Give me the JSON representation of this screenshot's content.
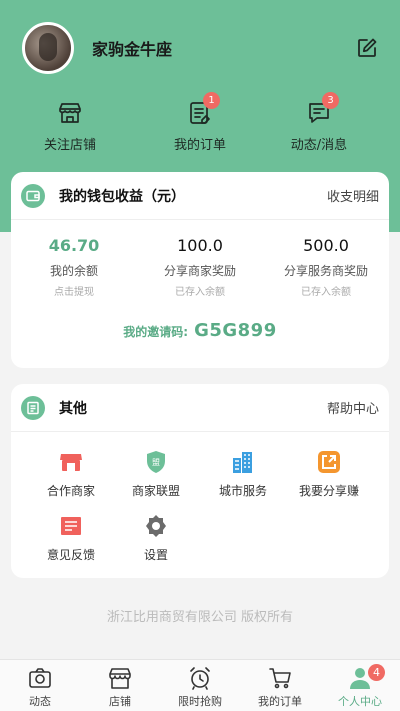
{
  "header": {
    "username": "家驹金牛座",
    "quick_links": [
      {
        "label": "关注店铺",
        "icon": "shop-icon",
        "badge": ""
      },
      {
        "label": "我的订单",
        "icon": "order-icon",
        "badge": "1"
      },
      {
        "label": "动态/消息",
        "icon": "message-icon",
        "badge": "3"
      }
    ]
  },
  "wallet": {
    "title": "我的钱包收益（元）",
    "link": "收支明细",
    "stats": [
      {
        "value": "46.70",
        "name": "我的余额",
        "hint": "点击提现"
      },
      {
        "value": "100.0",
        "name": "分享商家奖励",
        "hint": "已存入余额"
      },
      {
        "value": "500.0",
        "name": "分享服务商奖励",
        "hint": "已存入余额"
      }
    ],
    "invite_label": "我的邀请码:",
    "invite_code": "G5G899"
  },
  "other": {
    "title": "其他",
    "link": "帮助中心",
    "items": [
      {
        "label": "合作商家",
        "icon": "store-icon"
      },
      {
        "label": "商家联盟",
        "icon": "alliance-shield-icon"
      },
      {
        "label": "城市服务",
        "icon": "city-building-icon"
      },
      {
        "label": "我要分享赚",
        "icon": "share-icon"
      },
      {
        "label": "意见反馈",
        "icon": "feedback-icon"
      },
      {
        "label": "设置",
        "icon": "settings-gear-icon"
      }
    ]
  },
  "copyright": "浙江比用商贸有限公司 版权所有",
  "tabbar": {
    "items": [
      {
        "label": "动态",
        "icon": "camera-icon"
      },
      {
        "label": "店铺",
        "icon": "shop-icon"
      },
      {
        "label": "限时抢购",
        "icon": "alarm-clock-icon"
      },
      {
        "label": "我的订单",
        "icon": "cart-icon"
      },
      {
        "label": "个人中心",
        "icon": "person-icon",
        "badge": "4"
      }
    ],
    "active": "个人中心"
  },
  "colors": {
    "brand": "#6dbf98",
    "accent_text": "#5aab86",
    "badge": "#f06a63"
  }
}
